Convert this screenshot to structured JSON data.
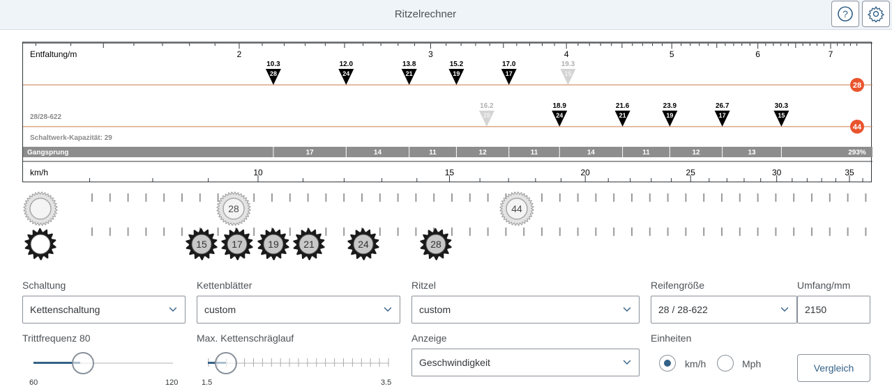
{
  "header": {
    "title": "Ritzelrechner",
    "help_icon": "help-icon",
    "settings_icon": "gear-icon"
  },
  "chart": {
    "entfaltung_label": "Entfaltung/m",
    "entfaltung_ticks": [
      "2",
      "3",
      "4",
      "5",
      "6",
      "7"
    ],
    "tire_label": "28/28-622",
    "capacity_label": "Schaltwerk-Kapazität: 29",
    "gangsprung_label": "Gangsprung",
    "gangsprung_values": [
      "17",
      "14",
      "11",
      "12",
      "11",
      "14",
      "11",
      "12",
      "13",
      "293%"
    ],
    "speed_label": "km/h",
    "speed_ticks": [
      "10",
      "15",
      "20",
      "25",
      "30",
      "35"
    ],
    "chainrings": [
      {
        "teeth": "28",
        "gears": [
          {
            "dev": "10.3",
            "cog": "28"
          },
          {
            "dev": "12.0",
            "cog": "24"
          },
          {
            "dev": "13.8",
            "cog": "21"
          },
          {
            "dev": "15.2",
            "cog": "19"
          },
          {
            "dev": "17.0",
            "cog": "17"
          },
          {
            "dev": "19.3",
            "cog": "15",
            "faded": true
          }
        ]
      },
      {
        "teeth": "44",
        "gears": [
          {
            "dev": "16.2",
            "cog": "28",
            "faded": true
          },
          {
            "dev": "18.9",
            "cog": "24"
          },
          {
            "dev": "21.6",
            "cog": "21"
          },
          {
            "dev": "23.9",
            "cog": "19"
          },
          {
            "dev": "26.7",
            "cog": "17"
          },
          {
            "dev": "30.3",
            "cog": "15"
          }
        ]
      }
    ],
    "accent_color": "#e9542d",
    "line_color": "#c87a4a"
  },
  "gears_row": {
    "chainrings": [
      "28",
      "44"
    ],
    "cogs": [
      "15",
      "17",
      "19",
      "21",
      "24",
      "28"
    ]
  },
  "form": {
    "schaltung_label": "Schaltung",
    "schaltung_value": "Kettenschaltung",
    "kettenblaetter_label": "Kettenblätter",
    "kettenblaetter_value": "custom",
    "ritzel_label": "Ritzel",
    "ritzel_value": "custom",
    "reifen_label": "Reifengröße",
    "reifen_value": "28 / 28-622",
    "umfang_label": "Umfang/mm",
    "umfang_value": "2150",
    "trittfrequenz_label": "Trittfrequenz 80",
    "trittfrequenz_min": "60",
    "trittfrequenz_max": "120",
    "trittfrequenz_value": 80,
    "schraeglauf_label": "Max. Kettenschräglauf",
    "schraeglauf_min": "1.5",
    "schraeglauf_max": "3.5",
    "schraeglauf_value": 1.7,
    "anzeige_label": "Anzeige",
    "anzeige_value": "Geschwindigkeit",
    "einheiten_label": "Einheiten",
    "unit_kmh": "km/h",
    "unit_mph": "Mph",
    "vergleich_label": "Vergleich"
  }
}
